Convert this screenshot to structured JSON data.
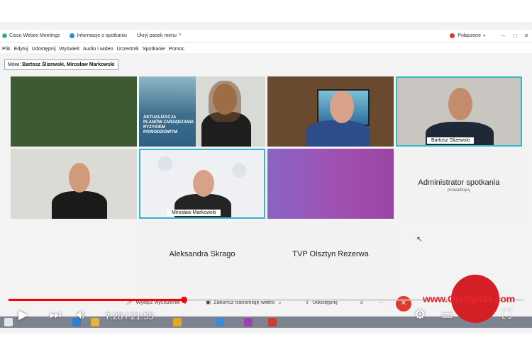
{
  "titlebar": {
    "app_name": "Cisco Webex Meetings",
    "info_label": "Informacje o spotkaniu",
    "hide_menu_label": "Ukryj pasek menu",
    "hide_menu_chevron": "^",
    "status_label": "Połączone",
    "status_arrow": "▾",
    "minimize": "–",
    "restore": "□",
    "close": "✕"
  },
  "menu": {
    "items": [
      "Plik",
      "Edytuj",
      "Udostępnij",
      "Wyświetl",
      "Audio i wideo",
      "Uczestnik",
      "Spotkanie",
      "Pomoc"
    ]
  },
  "speaking": {
    "label": "Mówi:",
    "names": "Bartosz Ślizewski, Mirosław Markowski"
  },
  "tiles": {
    "t2_banner": "AKTUALIZACJA PLANÓW ZARZĄDZANIA RYZYKIEM POWODZIOWYM",
    "t4_name": "Bartosz Ślizewski",
    "t6_name": "Mirosław Markowski",
    "t8_name": "Administrator spotkania",
    "t8_role": "prowadzący",
    "t9_name": "Aleksandra Skrago",
    "t10_name": "TVP Olsztyn Rezerwa"
  },
  "controls": {
    "mute_label": "Wyłącz wyciszenie",
    "video_label": "Zakończ transmisję wideo",
    "share_label": "Udostępnij",
    "reactions_icon": "☺",
    "more_label": "···",
    "end_icon": "✕"
  },
  "youtube": {
    "current_time": "7:28",
    "duration": "21:55",
    "time_display": "7:28 / 21:55",
    "progress_fraction": 0.3407
  },
  "watermark": {
    "text": "www.Olsztyn24.com"
  },
  "colors": {
    "accent_border": "#37b6c9",
    "progress": "#ff0000",
    "end_call": "#e23a2a",
    "watermark": "#e8252b"
  }
}
